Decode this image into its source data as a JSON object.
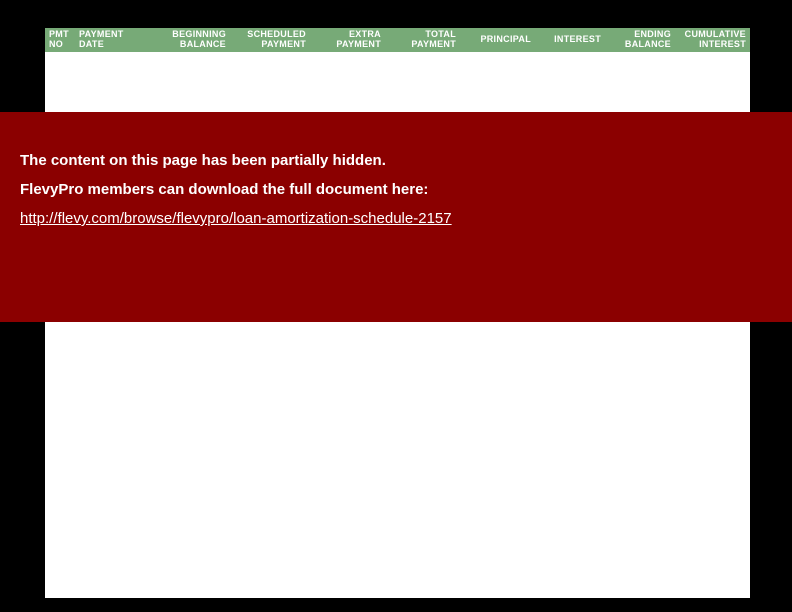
{
  "table": {
    "headers": [
      {
        "line1": "PMT",
        "line2": "NO"
      },
      {
        "line1": "PAYMENT",
        "line2": "DATE"
      },
      {
        "line1": "BEGINNING",
        "line2": "BALANCE"
      },
      {
        "line1": "SCHEDULED",
        "line2": "PAYMENT"
      },
      {
        "line1": "EXTRA",
        "line2": "PAYMENT"
      },
      {
        "line1": "TOTAL",
        "line2": "PAYMENT"
      },
      {
        "line1": "",
        "line2": "PRINCIPAL"
      },
      {
        "line1": "",
        "line2": "INTEREST"
      },
      {
        "line1": "ENDING",
        "line2": "BALANCE"
      },
      {
        "line1": "CUMULATIVE",
        "line2": "INTEREST"
      }
    ]
  },
  "overlay": {
    "line1": "The content on this page has been partially hidden.",
    "line2": "FlevyPro members can download the full document here:",
    "link_text": "http://flevy.com/browse/flevypro/loan-amortization-schedule-2157",
    "link_href": "http://flevy.com/browse/flevypro/loan-amortization-schedule-2157"
  }
}
